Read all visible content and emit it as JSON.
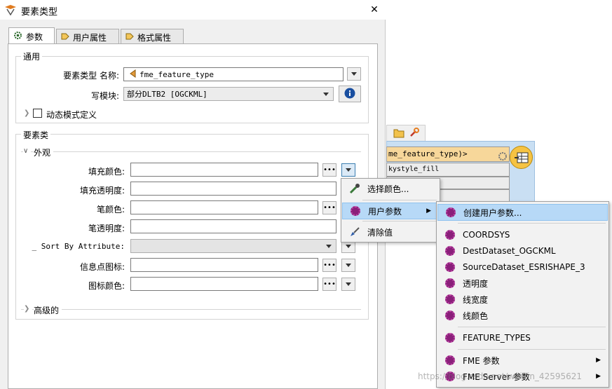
{
  "dialog": {
    "title": "要素类型",
    "close_glyph": "✕",
    "tabs": [
      {
        "label": "参数",
        "icon": "gear-icon"
      },
      {
        "label": "用户属性",
        "icon": "tag-arrow-icon"
      },
      {
        "label": "格式属性",
        "icon": "tag-arrow-icon"
      }
    ],
    "general": {
      "legend": "通用",
      "feature_type_label": "要素类型 名称:",
      "feature_type_value": "fme_feature_type",
      "writer_label": "写模块:",
      "writer_value": "部分DLTB2 [OGCKML]",
      "dynamic_schema_label": "动态模式定义"
    },
    "feature_class": {
      "legend": "要素类",
      "appearance_label": "外观",
      "fields": [
        {
          "label": "填充颜色:",
          "value": ""
        },
        {
          "label": "填充透明度:",
          "value": ""
        },
        {
          "label": "笔颜色:",
          "value": ""
        },
        {
          "label": "笔透明度:",
          "value": ""
        },
        {
          "label": "_ Sort By Attribute:",
          "value": ""
        },
        {
          "label": "信息点图标:",
          "value": ""
        },
        {
          "label": "图标颜色:",
          "value": ""
        }
      ],
      "advanced_label": "高级的"
    }
  },
  "canvas": {
    "node_header": "me_feature_type)>",
    "node_attr": "kystyle_fill"
  },
  "context_menu": {
    "items": [
      {
        "label": "选择颜色...",
        "icon": "eyedropper-icon"
      },
      {
        "label": "用户参数",
        "icon": "user-parameter-icon",
        "submenu": true
      },
      {
        "label": "清除值",
        "icon": "broom-icon"
      }
    ]
  },
  "submenu": {
    "items": [
      {
        "label": "创建用户参数..."
      },
      {
        "label": "COORDSYS"
      },
      {
        "label": "DestDataset_OGCKML"
      },
      {
        "label": "SourceDataset_ESRISHAPE_3"
      },
      {
        "label": "透明度"
      },
      {
        "label": "线宽度"
      },
      {
        "label": "线颜色"
      },
      {
        "label": "FEATURE_TYPES"
      },
      {
        "label": "FME 参数",
        "submenu": true
      },
      {
        "label": "FME Server 参数",
        "submenu": true
      }
    ]
  },
  "watermark": "https://blog.csdn.net/weixin_42595621"
}
